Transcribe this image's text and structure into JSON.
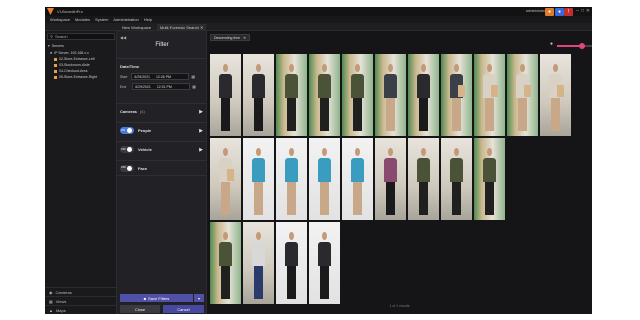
{
  "window": {
    "title": "VI-BoxedinPro",
    "user": "administrator",
    "controls": [
      "–",
      "□",
      "✕"
    ]
  },
  "menu": [
    "Workspace",
    "Modules",
    "System",
    "Administration",
    "Help"
  ],
  "tabs": [
    {
      "label": "New Workspace",
      "active": false
    },
    {
      "label": "Multi-Forensic Search",
      "active": true
    }
  ],
  "sidebar": {
    "search_label": "Search",
    "tree_header": "Servers",
    "server": "IP Server: 192.168.x.x",
    "cameras": [
      "02-Store-Entrance-Left",
      "03-Stockroom-Aisle",
      "04-Checkout-Area",
      "05-Store-Entrance-Right"
    ],
    "bottom": [
      "Cameras",
      "Views",
      "Maps"
    ]
  },
  "filter": {
    "title": "Filter",
    "section_datetime": "Date/Time",
    "start_label": "Start",
    "start_date": "6/29/2021",
    "start_time": "12:26 PM",
    "end_label": "End",
    "end_date": "6/29/2021",
    "end_time": "12:31 PM",
    "cameras_label": "Cameras",
    "cameras_count": "(4)",
    "people_label": "People",
    "people_toggle": "ON",
    "vehicle_label": "Vehicle",
    "vehicle_toggle": "OFF",
    "face_label": "Face",
    "face_toggle": "OFF",
    "save_label": "Save Filters",
    "close_label": "Close",
    "cancel_label": "Cancel"
  },
  "results": {
    "chip": "Descending time",
    "pager": "1 of 1 results",
    "zoom_level": 0.4,
    "colors": {
      "accent": "#e0457b",
      "primary": "#4a7bd8",
      "button": "#5050a8"
    }
  },
  "thumbnails": [
    {
      "scene": "store",
      "shirt": "#2a2a2e",
      "pants": "#1a1a1c",
      "box": false
    },
    {
      "scene": "store",
      "shirt": "#2a2a2e",
      "pants": "#1a1a1c",
      "box": false
    },
    {
      "scene": "aisle",
      "shirt": "#4a5238",
      "pants": "#20201e",
      "box": false
    },
    {
      "scene": "aisle",
      "shirt": "#4a5238",
      "pants": "#20201e",
      "box": false
    },
    {
      "scene": "aisle",
      "shirt": "#4a5238",
      "pants": "#20201e",
      "box": false
    },
    {
      "scene": "aisle",
      "shirt": "#3a3f48",
      "pants": "#c8a888",
      "box": false
    },
    {
      "scene": "aisle",
      "shirt": "#2a2a2e",
      "pants": "#1a1a1c",
      "box": false
    },
    {
      "scene": "aisle",
      "shirt": "#3a3f48",
      "pants": "#c8a888",
      "box": true
    },
    {
      "scene": "aisle",
      "shirt": "#d9d2c4",
      "pants": "#c8a888",
      "box": true
    },
    {
      "scene": "aisle",
      "shirt": "#d9d2c4",
      "pants": "#c8a888",
      "box": true
    },
    {
      "scene": "store",
      "shirt": "#d9d2c4",
      "pants": "#c8a888",
      "box": true
    },
    {
      "scene": "store",
      "shirt": "#d9d2c4",
      "pants": "#c8a888",
      "box": true
    },
    {
      "scene": "blank",
      "shirt": "#3a9dc0",
      "pants": "#c8a888",
      "box": false
    },
    {
      "scene": "blank",
      "shirt": "#3a9dc0",
      "pants": "#c8a888",
      "box": false
    },
    {
      "scene": "blank",
      "shirt": "#3a9dc0",
      "pants": "#c8a888",
      "box": false
    },
    {
      "scene": "blank",
      "shirt": "#3a9dc0",
      "pants": "#c8a888",
      "box": false
    },
    {
      "scene": "store",
      "shirt": "#8a4a70",
      "pants": "#1a1a1c",
      "box": false
    },
    {
      "scene": "store",
      "shirt": "#4a5238",
      "pants": "#20201e",
      "box": false
    },
    {
      "scene": "store",
      "shirt": "#4a5238",
      "pants": "#20201e",
      "box": false
    },
    {
      "scene": "aisle",
      "shirt": "#4a5238",
      "pants": "#20201e",
      "box": false
    },
    {
      "scene": "aisle",
      "shirt": "#4a5238",
      "pants": "#20201e",
      "box": false
    },
    {
      "scene": "store",
      "shirt": "#d8d8d8",
      "pants": "#2a3a6a",
      "box": false
    },
    {
      "scene": "blank",
      "shirt": "#2a2a2e",
      "pants": "#1a1a1c",
      "box": false
    },
    {
      "scene": "blank",
      "shirt": "#2a2a2e",
      "pants": "#1a1a1c",
      "box": false
    }
  ]
}
